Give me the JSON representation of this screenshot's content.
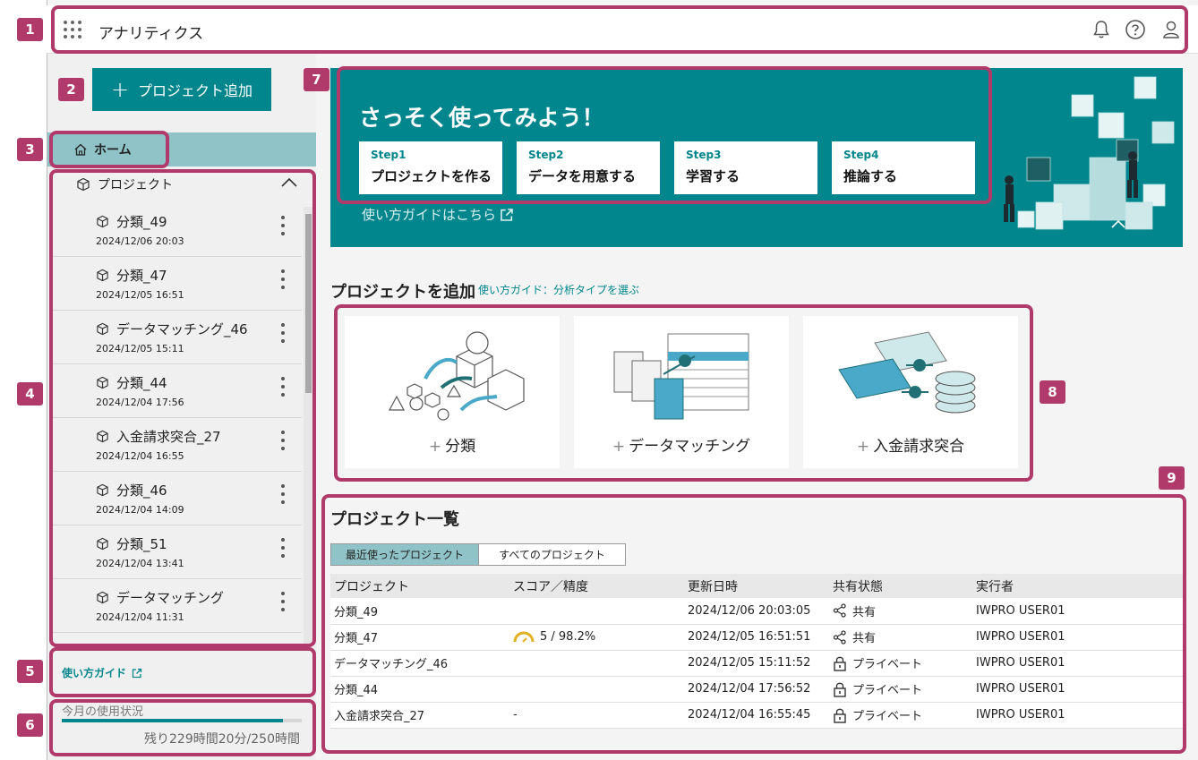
{
  "header": {
    "title": "アナリティクス"
  },
  "sidebar": {
    "add_project_label": "プロジェクト追加",
    "home_label": "ホーム",
    "projects_label": "プロジェクト",
    "items": [
      {
        "name": "分類_49",
        "date": "2024/12/06 20:03"
      },
      {
        "name": "分類_47",
        "date": "2024/12/05 16:51"
      },
      {
        "name": "データマッチング_46",
        "date": "2024/12/05 15:11"
      },
      {
        "name": "分類_44",
        "date": "2024/12/04 17:56"
      },
      {
        "name": "入金請求突合_27",
        "date": "2024/12/04 16:55"
      },
      {
        "name": "分類_46",
        "date": "2024/12/04 14:09"
      },
      {
        "name": "分類_51",
        "date": "2024/12/04 13:41"
      },
      {
        "name": "データマッチング",
        "date": "2024/12/04 11:31"
      }
    ],
    "guide_link": "使い方ガイド",
    "usage_label": "今月の使用状況",
    "usage_fraction": 0.92,
    "usage_text": "残り229時間20分/250時間"
  },
  "banner": {
    "title": "さっそく使ってみよう！",
    "steps": [
      {
        "num": "Step1",
        "label": "プロジェクトを作る"
      },
      {
        "num": "Step2",
        "label": "データを用意する"
      },
      {
        "num": "Step3",
        "label": "学習する"
      },
      {
        "num": "Step4",
        "label": "推論する"
      }
    ],
    "guide": "使い方ガイドはこちら"
  },
  "add_section": {
    "heading": "プロジェクトを追加",
    "guide": "使い方ガイド：分析タイプを選ぶ",
    "cards": [
      {
        "label": "分類"
      },
      {
        "label": "データマッチング"
      },
      {
        "label": "入金請求突合"
      }
    ]
  },
  "project_list": {
    "heading": "プロジェクト一覧",
    "tabs": [
      "最近使ったプロジェクト",
      "すべてのプロジェクト"
    ],
    "columns": [
      "プロジェクト",
      "スコア／精度",
      "更新日時",
      "共有状態",
      "実行者"
    ],
    "rows": [
      {
        "project": "分類_49",
        "score": "",
        "updated": "2024/12/06 20:03:05",
        "share": "共有",
        "share_icon": "share-icon",
        "runner": "IWPRO USER01"
      },
      {
        "project": "分類_47",
        "score": "5 / 98.2%",
        "updated": "2024/12/05 16:51:51",
        "share": "共有",
        "share_icon": "share-icon",
        "runner": "IWPRO USER01"
      },
      {
        "project": "データマッチング_46",
        "score": "",
        "updated": "2024/12/05 15:11:52",
        "share": "プライベート",
        "share_icon": "lock-icon",
        "runner": "IWPRO USER01"
      },
      {
        "project": "分類_44",
        "score": "",
        "updated": "2024/12/04 17:56:52",
        "share": "プライベート",
        "share_icon": "lock-icon",
        "runner": "IWPRO USER01"
      },
      {
        "project": "入金請求突合_27",
        "score": "-",
        "updated": "2024/12/04 16:55:45",
        "share": "プライベート",
        "share_icon": "lock-icon",
        "runner": "IWPRO USER01"
      }
    ]
  },
  "annotations": [
    "1",
    "2",
    "3",
    "4",
    "5",
    "6",
    "7",
    "8",
    "9"
  ],
  "colors": {
    "accent": "#00868c",
    "annotation": "#b03a6a",
    "home_bg": "#8fc3c7"
  }
}
